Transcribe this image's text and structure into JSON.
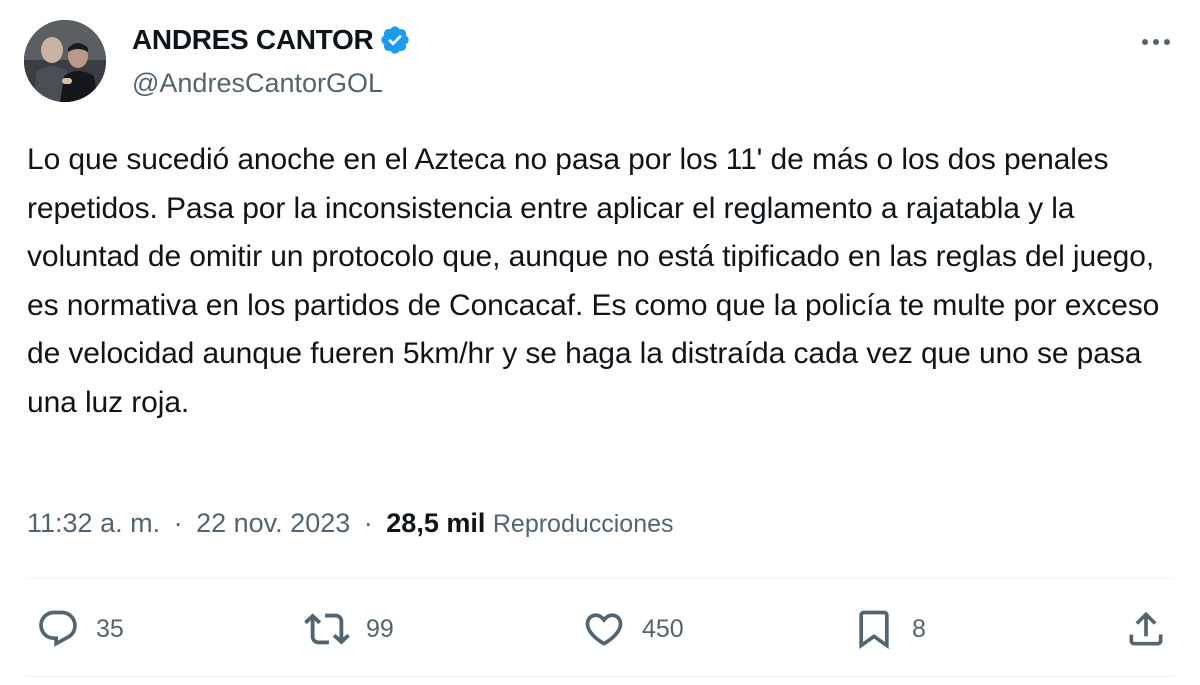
{
  "author": {
    "name": "ANDRES CANTOR",
    "handle": "@AndresCantorGOL"
  },
  "tweet": {
    "text": "Lo que sucedió anoche en el Azteca no pasa por los 11' de más o los dos penales repetidos. Pasa por la inconsistencia entre aplicar el reglamento a rajatabla y la voluntad de omitir un protocolo que, aunque no está tipificado en las reglas del juego, es normativa en los partidos de Concacaf. Es como que la policía te multe por exceso de velocidad aunque fueren 5km/hr y se haga la distraída cada vez que uno se pasa una luz roja."
  },
  "meta": {
    "time": "11:32 a. m.",
    "separator": "·",
    "date": "22 nov. 2023",
    "views_count": "28,5 mil",
    "views_label": "Reproducciones"
  },
  "actions": {
    "replies": "35",
    "retweets": "99",
    "likes": "450",
    "bookmarks": "8"
  },
  "icons": {
    "verified": "verified-badge-icon",
    "more": "more-dots-icon",
    "reply": "reply-icon",
    "retweet": "retweet-icon",
    "like": "heart-icon",
    "bookmark": "bookmark-icon",
    "share": "share-icon"
  },
  "colors": {
    "verified": "#1d9bf0",
    "text": "#0f1419",
    "secondary": "#536471",
    "divider": "#eff3f4"
  }
}
